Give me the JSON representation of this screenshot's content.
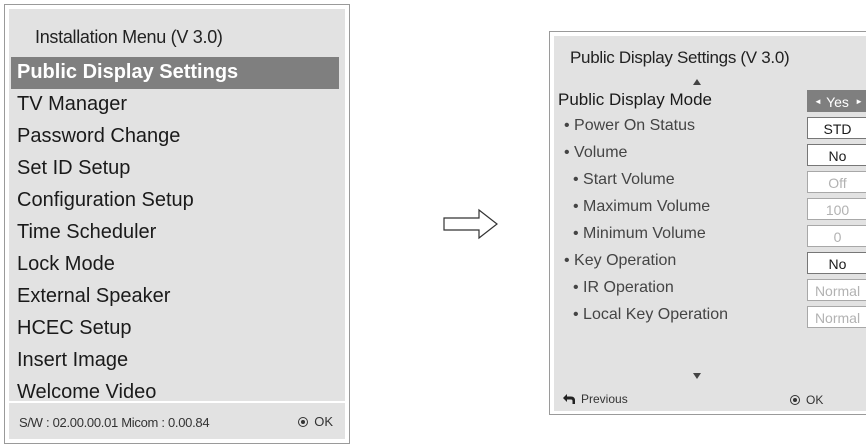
{
  "installation_menu": {
    "title": "Installation Menu (V 3.0)",
    "items": [
      {
        "label": "Public Display Settings",
        "selected": true
      },
      {
        "label": "TV Manager"
      },
      {
        "label": "Password Change"
      },
      {
        "label": "Set ID Setup"
      },
      {
        "label": "Configuration Setup"
      },
      {
        "label": "Time Scheduler"
      },
      {
        "label": "Lock Mode"
      },
      {
        "label": "External Speaker"
      },
      {
        "label": "HCEC Setup"
      },
      {
        "label": "Insert Image"
      },
      {
        "label": "Welcome Video"
      }
    ],
    "footer": {
      "version_text": "S/W : 02.00.00.01 Micom : 0.00.84",
      "ok_label": "OK"
    }
  },
  "public_display_settings": {
    "title": "Public Display Settings (V 3.0)",
    "rows": [
      {
        "label": "Public Display Mode",
        "value": "Yes",
        "state": "active"
      },
      {
        "label": "• Power On Status",
        "value": "STD",
        "state": "normal"
      },
      {
        "label": "• Volume",
        "value": "No",
        "state": "normal"
      },
      {
        "label": "• Start Volume",
        "value": "Off",
        "state": "disabled"
      },
      {
        "label": "• Maximum Volume",
        "value": "100",
        "state": "disabled"
      },
      {
        "label": "• Minimum Volume",
        "value": "0",
        "state": "disabled"
      },
      {
        "label": "• Key Operation",
        "value": "No",
        "state": "normal"
      },
      {
        "label": "• IR Operation",
        "value": "Normal",
        "state": "disabled"
      },
      {
        "label": "• Local Key Operation",
        "value": "Normal",
        "state": "disabled"
      }
    ],
    "footer": {
      "previous_label": "Previous",
      "ok_label": "OK"
    }
  },
  "icons": {
    "arrow": "right-arrow-outline-icon",
    "previous": "return-arrow-icon",
    "ok": "ok-button-icon",
    "scroll_up": "scroll-up-icon",
    "scroll_down": "scroll-down-icon"
  },
  "colors": {
    "panel_bg": "#e2e2e2",
    "selected_bg": "#7f7f7f",
    "disabled_text": "#b2b2b2"
  }
}
